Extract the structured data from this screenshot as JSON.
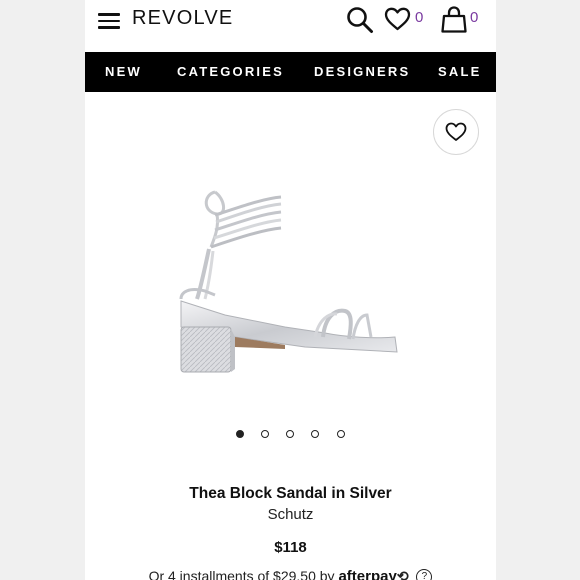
{
  "header": {
    "logo": "REVOLVE",
    "wishlist_count": "0",
    "cart_count": "0"
  },
  "nav": {
    "items": [
      "NEW",
      "CATEGORIES",
      "DESIGNERS",
      "SALE"
    ]
  },
  "gallery": {
    "image_count": 5,
    "active_index": 0
  },
  "product": {
    "title": "Thea Block Sandal in Silver",
    "brand": "Schutz",
    "price": "$118",
    "installment_text": "Or 4 installments of $29.50 by",
    "installment_provider": "afterpay",
    "help_symbol": "?"
  },
  "colors": {
    "nav_bg": "#000000",
    "count_accent": "#7a3aa0"
  }
}
